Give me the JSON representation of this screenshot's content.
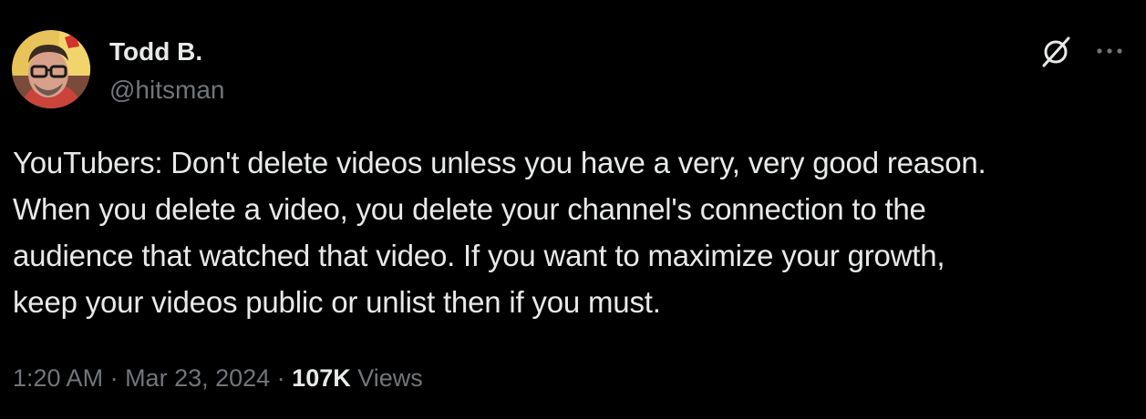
{
  "author": {
    "display_name": "Todd B.",
    "handle": "@hitsman",
    "avatar_icon": "user-avatar-photo"
  },
  "actions": {
    "grok_icon": "grok-icon",
    "more_icon": "more-options-icon"
  },
  "tweet": {
    "lines": [
      "YouTubers: Don't delete videos unless you have a very, very good reason.",
      "When you delete a video, you delete your channel's connection to the",
      "audience that watched that video. If you want to maximize your growth,",
      "keep your videos public or unlist then if you must."
    ]
  },
  "meta": {
    "time": "1:20 AM",
    "separator": " · ",
    "date": "Mar 23, 2024",
    "views_count": "107K",
    "views_label": " Views"
  },
  "colors": {
    "background": "#000000",
    "primary_text": "#e7e9ea",
    "secondary_text": "#71767b"
  }
}
